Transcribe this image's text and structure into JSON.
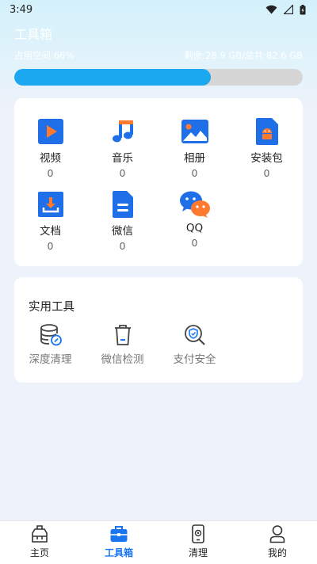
{
  "status_bar": {
    "time": "3:49"
  },
  "header": {
    "title": "工具箱",
    "storage_used": "占用空间:66%",
    "storage_remaining": "剩余:28.9 GB/",
    "storage_total": "总共:82.6 GB",
    "usage_fraction": 0.68
  },
  "files": [
    {
      "label": "视频",
      "count": "0",
      "icon": "video-icon"
    },
    {
      "label": "音乐",
      "count": "0",
      "icon": "music-icon"
    },
    {
      "label": "相册",
      "count": "0",
      "icon": "album-icon"
    },
    {
      "label": "安装包",
      "count": "0",
      "icon": "apk-icon"
    },
    {
      "label": "文档",
      "count": "0",
      "icon": "document-icon"
    },
    {
      "label": "微信",
      "count": "0",
      "icon": "wechat-file-icon"
    },
    {
      "label": "QQ",
      "count": "0",
      "icon": "wechat-logo-icon"
    }
  ],
  "tools": {
    "title": "实用工具",
    "items": [
      {
        "label": "深度清理",
        "icon": "database-clean-icon"
      },
      {
        "label": "微信检测",
        "icon": "trash-bin-icon"
      },
      {
        "label": "支付安全",
        "icon": "search-shield-icon"
      }
    ]
  },
  "tabbar": {
    "items": [
      {
        "label": "主页",
        "icon": "home-icon"
      },
      {
        "label": "工具箱",
        "icon": "toolbox-icon"
      },
      {
        "label": "清理",
        "icon": "phone-clean-icon"
      },
      {
        "label": "我的",
        "icon": "profile-icon"
      }
    ],
    "active_index": 1
  },
  "colors": {
    "accent": "#1976f0",
    "progress": "#1ba8f0",
    "wechat_green": "#22c06b",
    "wechat_orange": "#f07a2a"
  }
}
